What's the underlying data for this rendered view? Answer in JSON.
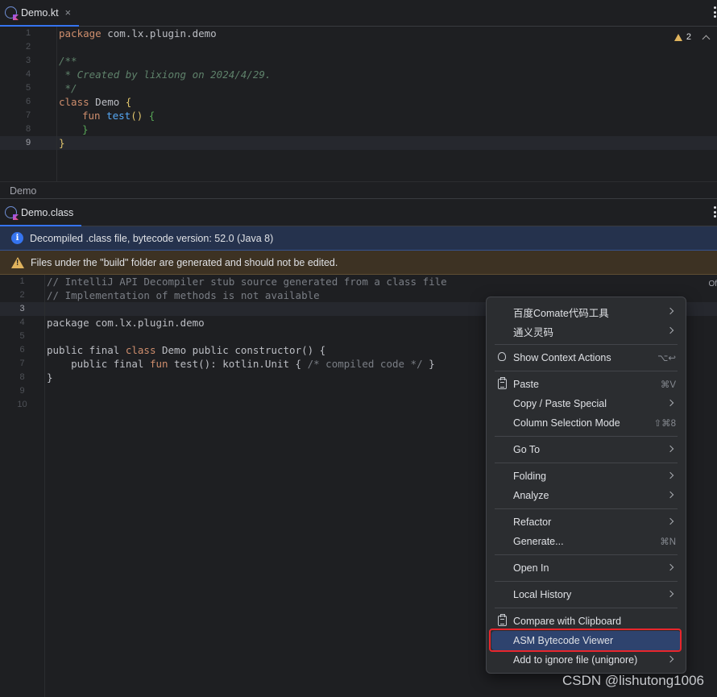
{
  "top_tab": {
    "label": "Demo.kt",
    "close": "×"
  },
  "inspection": {
    "warning_count": "2"
  },
  "top_gutter": [
    "1",
    "2",
    "3",
    "4",
    "5",
    "6",
    "7",
    "8",
    "9"
  ],
  "breadcrumb": "Demo",
  "bottom_tab": {
    "label": "Demo.class"
  },
  "info_banner": "Decompiled .class file, bytecode version: 52.0 (Java 8)",
  "warn_banner": "Files under the \"build\" folder are generated and should not be edited.",
  "side_text": "Of",
  "bottom_gutter": [
    "1",
    "2",
    "3",
    "4",
    "5",
    "6",
    "7",
    "8",
    "9",
    "10"
  ],
  "top_code": {
    "l1_kw": "package",
    "l1_rest": " com.lx.plugin.demo",
    "l3": "/**",
    "l4": " * Created by lixiong on 2024/4/29.",
    "l5": " */",
    "l6_kw": "class",
    "l6_name": " Demo ",
    "l6_brace": "{",
    "l7_kw": "fun",
    "l7_fn": " test",
    "l7_paren": "()",
    "l7_brace": " {",
    "l8_brace": "}",
    "l9_brace": "}"
  },
  "bottom_code": {
    "l1": "// IntelliJ API Decompiler stub source generated from a class file",
    "l2": "// Implementation of methods is not available",
    "l4": "package com.lx.plugin.demo",
    "l6_a": "public final ",
    "l6_kw": "class",
    "l6_b": " Demo public constructor() {",
    "l7_a": "    public final ",
    "l7_kw": "fun",
    "l7_b": " test(): kotlin.Unit { ",
    "l7_cmt": "/* compiled code */",
    "l7_c": " }",
    "l8": "}"
  },
  "menu": {
    "baidu": "百度Comate代码工具",
    "tongyi": "通义灵码",
    "show_context_actions": "Show Context Actions",
    "show_context_actions_sc": "⌥↩",
    "paste": "Paste",
    "paste_sc": "⌘V",
    "copy_paste_special": "Copy / Paste Special",
    "column_selection": "Column Selection Mode",
    "column_selection_sc": "⇧⌘8",
    "go_to": "Go To",
    "folding": "Folding",
    "analyze": "Analyze",
    "refactor": "Refactor",
    "generate": "Generate...",
    "generate_sc": "⌘N",
    "open_in": "Open In",
    "local_history": "Local History",
    "compare_clipboard": "Compare with Clipboard",
    "asm_viewer": "ASM Bytecode Viewer",
    "add_ignore": "Add to ignore file (unignore)"
  },
  "watermark": "CSDN @lishutong1006",
  "colors": {
    "accent": "#3574f0",
    "highlight_box": "#e8262c",
    "selected_item": "#2e436e"
  }
}
